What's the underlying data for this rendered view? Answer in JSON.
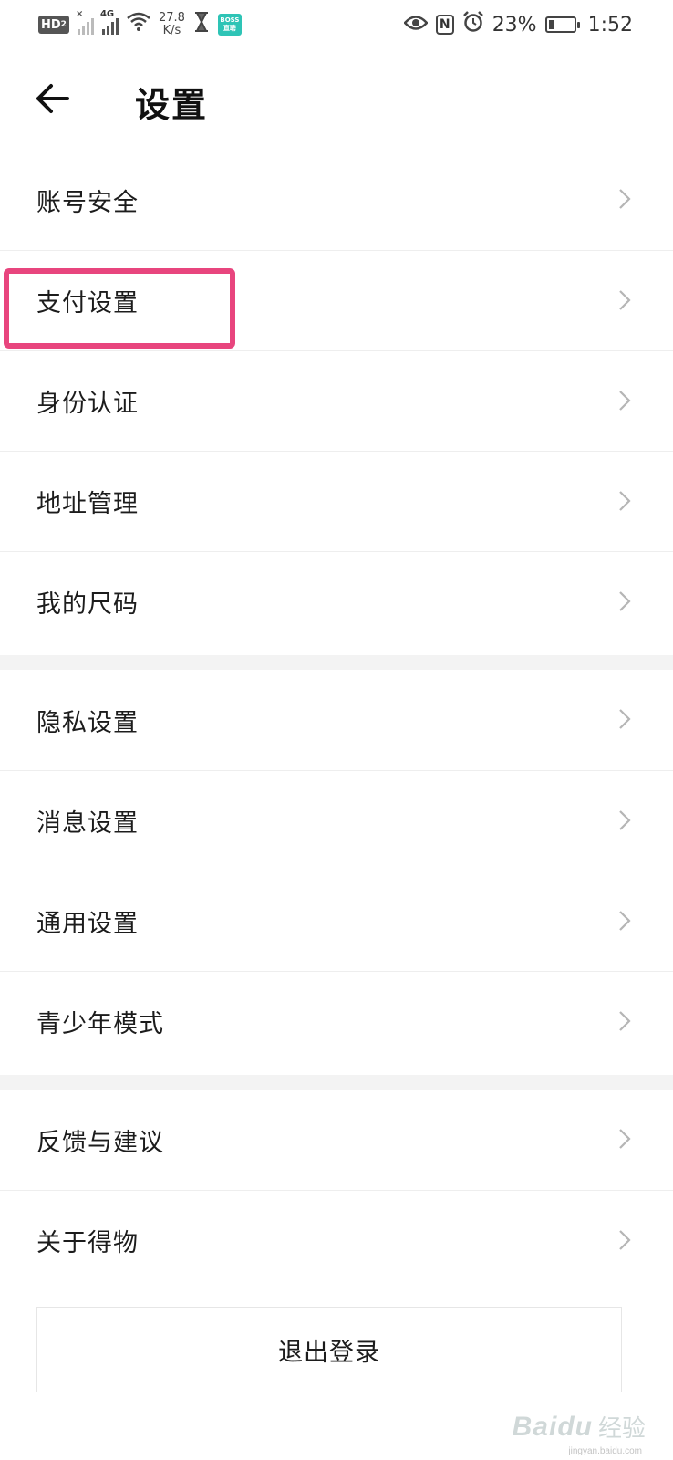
{
  "status_bar": {
    "hd_label": "HD",
    "hd_sub": "2",
    "network_type": "4G",
    "speed_value": "27.8",
    "speed_unit": "K/s",
    "boss_top": "BOSS",
    "boss_bottom": "直聘",
    "battery_percent": "23%",
    "battery_level": 0.23,
    "nfc_label": "N",
    "time": "1:52"
  },
  "header": {
    "title": "设置"
  },
  "groups": [
    {
      "items": [
        {
          "label": "账号安全"
        },
        {
          "label": "支付设置"
        },
        {
          "label": "身份认证"
        },
        {
          "label": "地址管理"
        },
        {
          "label": "我的尺码"
        }
      ]
    },
    {
      "items": [
        {
          "label": "隐私设置"
        },
        {
          "label": "消息设置"
        },
        {
          "label": "通用设置"
        },
        {
          "label": "青少年模式"
        }
      ]
    },
    {
      "items": [
        {
          "label": "反馈与建议"
        },
        {
          "label": "关于得物"
        }
      ]
    }
  ],
  "logout_label": "退出登录",
  "watermark": {
    "logo": "Baidu",
    "suffix": "经验",
    "url": "jingyan.baidu.com"
  },
  "colors": {
    "highlight": "#e8457e",
    "separator": "#f3f3f3",
    "chevron": "#b5b5b5"
  }
}
